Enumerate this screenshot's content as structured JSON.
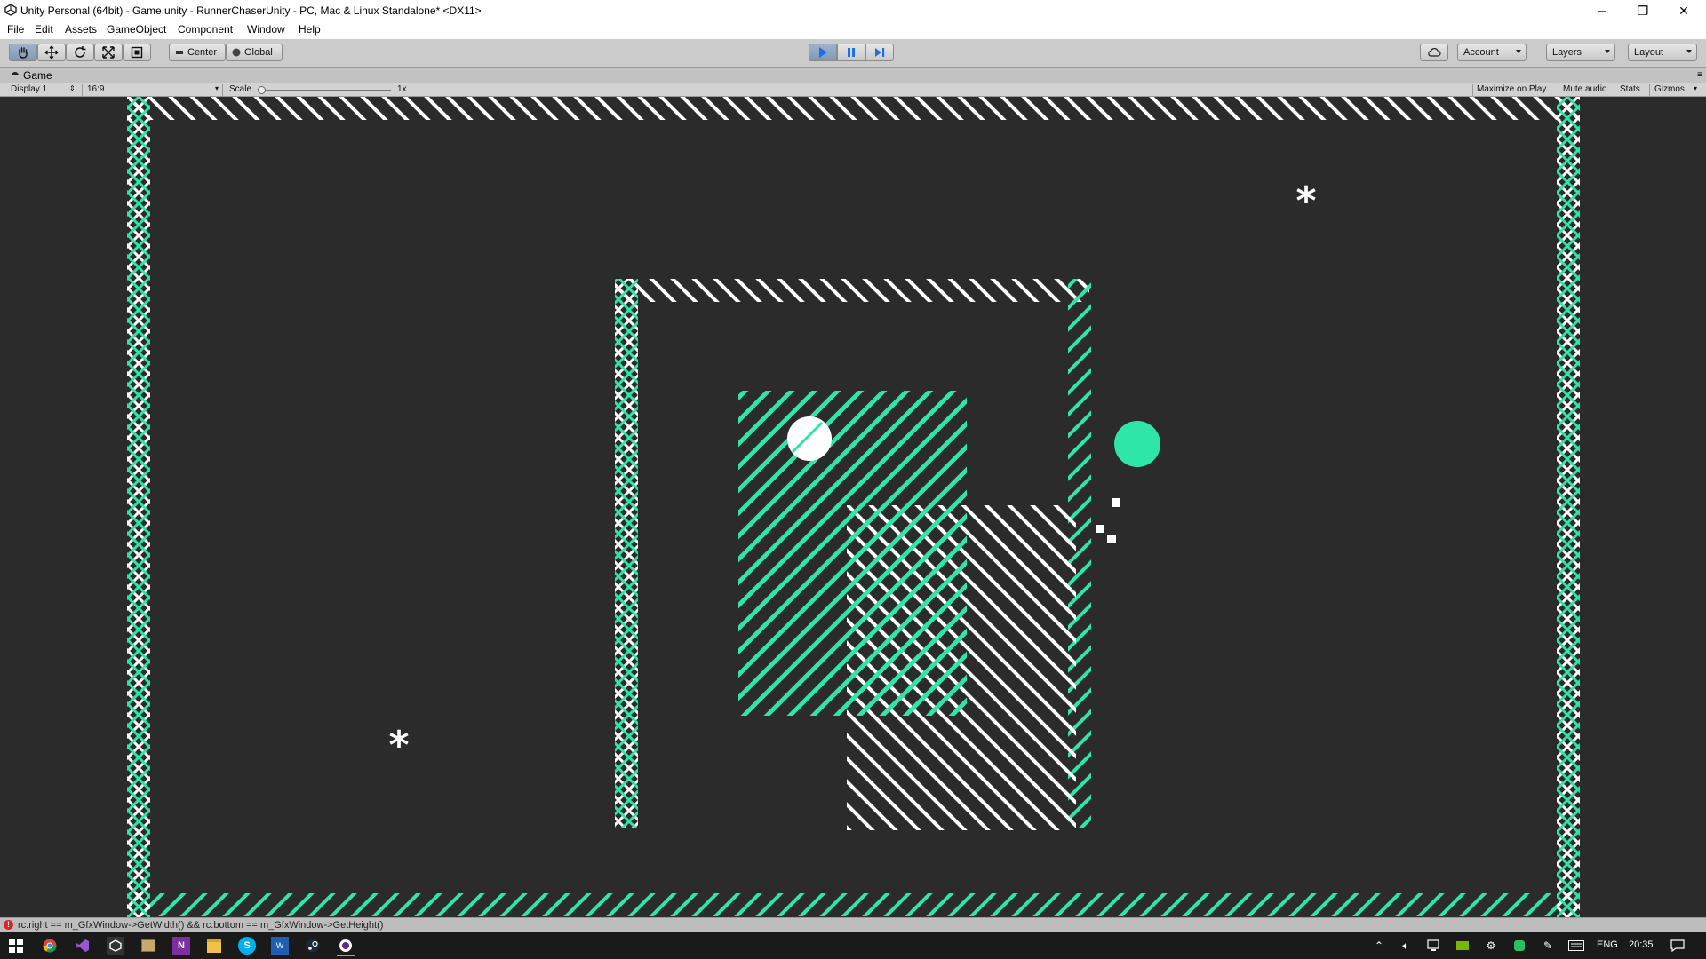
{
  "window": {
    "title": "Unity Personal (64bit) - Game.unity - RunnerChaserUnity - PC, Mac & Linux Standalone* <DX11>",
    "minimize": "─",
    "maximize": "❐",
    "close": "✕"
  },
  "menu": [
    "File",
    "Edit",
    "Assets",
    "GameObject",
    "Component",
    "Window",
    "Help"
  ],
  "toolbar": {
    "pivot_label": "Center",
    "space_label": "Global",
    "account_label": "Account",
    "layers_label": "Layers",
    "layout_label": "Layout",
    "play_state": "playing",
    "accent": "#3b7fd6"
  },
  "game_view": {
    "tab_label": "Game",
    "display": "Display 1",
    "aspect": "16:9",
    "scale_label": "Scale",
    "scale_value": "1x",
    "maximize_on_play": "Maximize on Play",
    "mute_audio": "Mute audio",
    "stats": "Stats",
    "gizmos": "Gizmos"
  },
  "scene": {
    "background": "#2b2b2b",
    "accent_color": "#2ee6a8",
    "white": "#ffffff",
    "collectible_glyph": "*"
  },
  "console": {
    "error": "rc.right == m_GfxWindow->GetWidth() && rc.bottom == m_GfxWindow->GetHeight()"
  },
  "taskbar": {
    "language": "ENG",
    "clock": "20:35"
  }
}
